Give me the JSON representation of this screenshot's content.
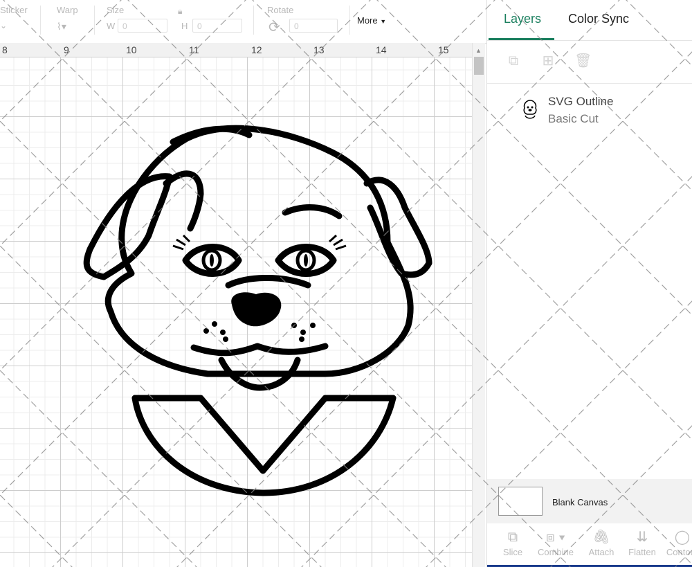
{
  "toolbar": {
    "sticker_label": "Sticker",
    "warp_label": "Warp",
    "size_label": "Size",
    "width_prefix": "W",
    "width_value": "0",
    "height_prefix": "H",
    "height_value": "0",
    "rotate_label": "Rotate",
    "rotate_value": "0",
    "more_label": "More"
  },
  "ruler": {
    "ticks": [
      "8",
      "9",
      "10",
      "11",
      "12",
      "13",
      "14",
      "15"
    ]
  },
  "panel": {
    "tabs": [
      {
        "label": "Layers",
        "active": true
      },
      {
        "label": "Color Sync",
        "active": false
      }
    ],
    "icons": [
      "group-icon",
      "duplicate-icon",
      "delete-icon"
    ],
    "layer": {
      "name": "SVG Outline",
      "operation": "Basic Cut"
    },
    "blank_canvas_label": "Blank Canvas",
    "actions": [
      {
        "label": "Slice",
        "icon": "slice-icon"
      },
      {
        "label": "Combine",
        "icon": "combine-icon"
      },
      {
        "label": "Attach",
        "icon": "attach-icon"
      },
      {
        "label": "Flatten",
        "icon": "flatten-icon"
      },
      {
        "label": "Contour",
        "icon": "contour-icon"
      }
    ]
  },
  "colors": {
    "accent": "#1a7f5e",
    "bottom_bar": "#1a3b8c"
  }
}
